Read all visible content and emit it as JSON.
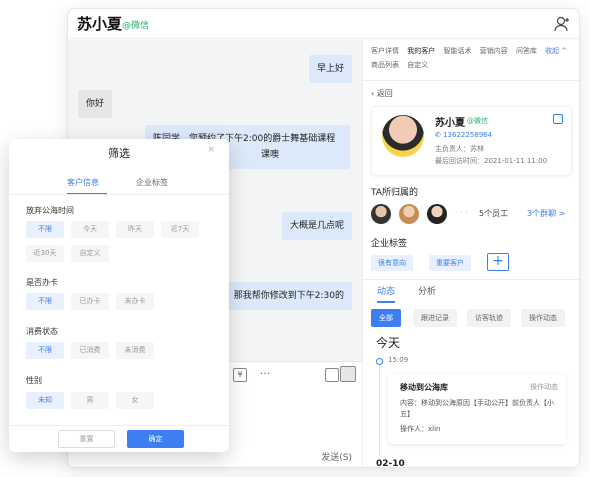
{
  "window": {
    "title": "苏小夏",
    "wechat_tag": "@微信",
    "add_icon": "add-user-icon"
  },
  "chat": {
    "messages": [
      {
        "side": "me",
        "text": "早上好"
      },
      {
        "side": "other",
        "text": "你好"
      },
      {
        "side": "me",
        "line1": "陈同学，您预约了下午2:00的爵士舞基础课程",
        "line2": "课噢"
      },
      {
        "side": "me",
        "text": "大概是几点呢"
      },
      {
        "side": "me",
        "text": "那我帮你修改到下午2:30的"
      }
    ],
    "send_label": "发送(S)"
  },
  "panel": {
    "tabs": [
      "客户详情",
      "我的客户",
      "智能话术",
      "营销内容",
      "问答库",
      "收起 ^",
      "商品列表",
      "自定义"
    ],
    "back_label": "返回",
    "customer": {
      "name": "苏小夏",
      "wechat": "@微信",
      "phone": "13622258964",
      "owner": "主负责人：苏林",
      "last_visit": "最后回访时间：2021-01-11 11:00"
    },
    "staff_title": "TA所归属的",
    "staff_count": "5个员工",
    "group_link": "3个群聊 >",
    "tag_title": "企业标签",
    "tags": [
      "很有意向",
      "重要客户"
    ],
    "tag_add": "+",
    "dyn_tabs": [
      "动态",
      "分析"
    ],
    "filters": [
      "全部",
      "跟进记录",
      "访客轨迹",
      "操作动态"
    ],
    "today": "今天",
    "event": {
      "time": "15:09",
      "title": "移动到公海库",
      "type": "操作动态",
      "content": "内容：移动到公海原因【手动公开】前负责人【小五】",
      "operator": "操作人：xlin"
    },
    "next_date": "02-10"
  },
  "filter_modal": {
    "title": "筛选",
    "close": "×",
    "tabs": [
      "客户信息",
      "企业标签"
    ],
    "groups": [
      {
        "label": "放弃公海时间",
        "options": [
          "不限",
          "今天",
          "昨天",
          "近7天",
          "近30天",
          "自定义"
        ],
        "selected": 0
      },
      {
        "label": "是否办卡",
        "options": [
          "不限",
          "已办卡",
          "未办卡"
        ],
        "selected": 0
      },
      {
        "label": "消费状态",
        "options": [
          "不限",
          "已消费",
          "未消费"
        ],
        "selected": 0
      },
      {
        "label": "性别",
        "options": [
          "未知",
          "男",
          "女"
        ],
        "selected": 0
      }
    ],
    "reset": "重置",
    "confirm": "确定"
  },
  "colors": {
    "accent": "#3d7ef1",
    "wechat_green": "#2aae67"
  }
}
